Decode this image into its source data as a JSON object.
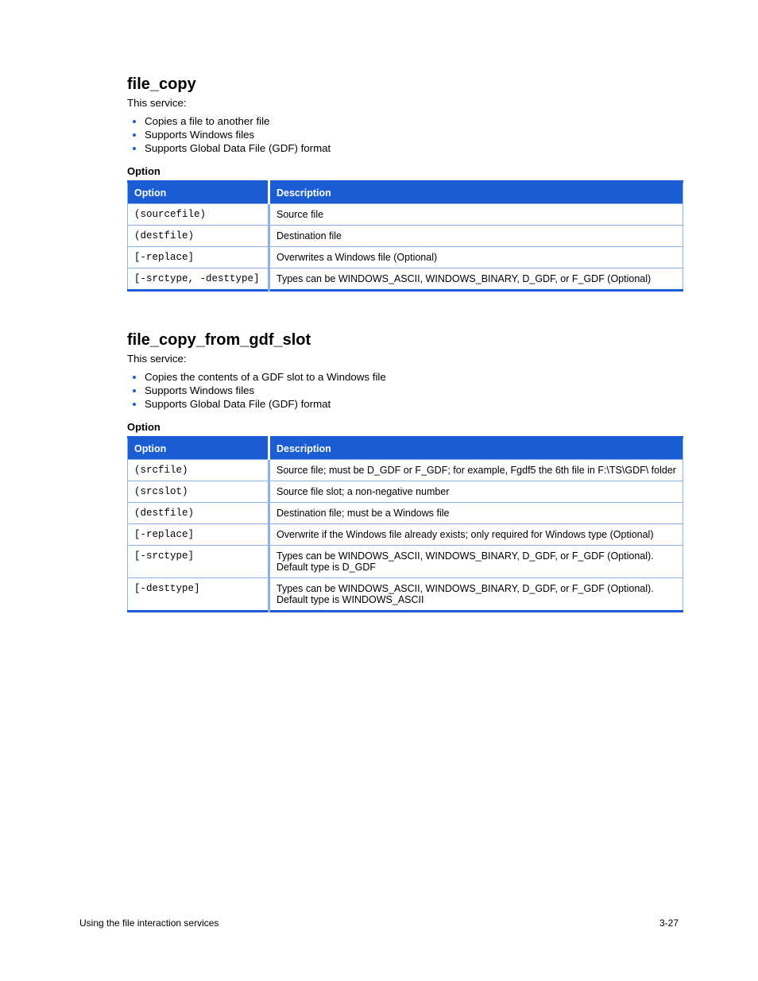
{
  "sections": [
    {
      "title": "file_copy",
      "intro": "This service:",
      "bullets": [
        "Copies a file to another file",
        "Supports Windows files",
        "Supports Global Data File (GDF) format"
      ],
      "tableCaption": "Option",
      "tableHeaders": [
        "Option",
        "Description"
      ],
      "rows": [
        {
          "opt": "(sourcefile)",
          "desc": "Source file"
        },
        {
          "opt": "(destfile)",
          "desc": "Destination file"
        },
        {
          "opt": "[-replace]",
          "desc": "Overwrites a Windows file (Optional)"
        },
        {
          "opt": "[-srctype, -desttype]",
          "desc": "Types can be WINDOWS_ASCII, WINDOWS_BINARY, D_GDF, or F_GDF (Optional)"
        }
      ]
    },
    {
      "title": "file_copy_from_gdf_slot",
      "intro": "This service:",
      "bullets": [
        "Copies the contents of a GDF slot to a Windows file",
        "Supports Windows files",
        "Supports Global Data File (GDF) format"
      ],
      "tableCaption": "Option",
      "tableHeaders": [
        "Option",
        "Description"
      ],
      "rows": [
        {
          "opt": "(srcfile)",
          "desc": "Source file; must be D_GDF or F_GDF; for example, Fgdf5 the 6th file in F:\\TS\\GDF\\ folder"
        },
        {
          "opt": "(srcslot)",
          "desc": "Source file slot; a non-negative number"
        },
        {
          "opt": "(destfile)",
          "desc": "Destination file; must be a Windows file"
        },
        {
          "opt": "[-replace]",
          "desc": "Overwrite if the Windows file already exists; only required for Windows type (Optional)"
        },
        {
          "opt": "[-srctype]",
          "desc": "Types can be WINDOWS_ASCII, WINDOWS_BINARY, D_GDF, or F_GDF (Optional). Default type is D_GDF"
        },
        {
          "opt": "[-desttype]",
          "desc": "Types can be WINDOWS_ASCII, WINDOWS_BINARY, D_GDF, or F_GDF (Optional). Default type is WINDOWS_ASCII"
        }
      ]
    }
  ],
  "footer": {
    "left": "Using the file interaction services",
    "right": "3-27"
  }
}
